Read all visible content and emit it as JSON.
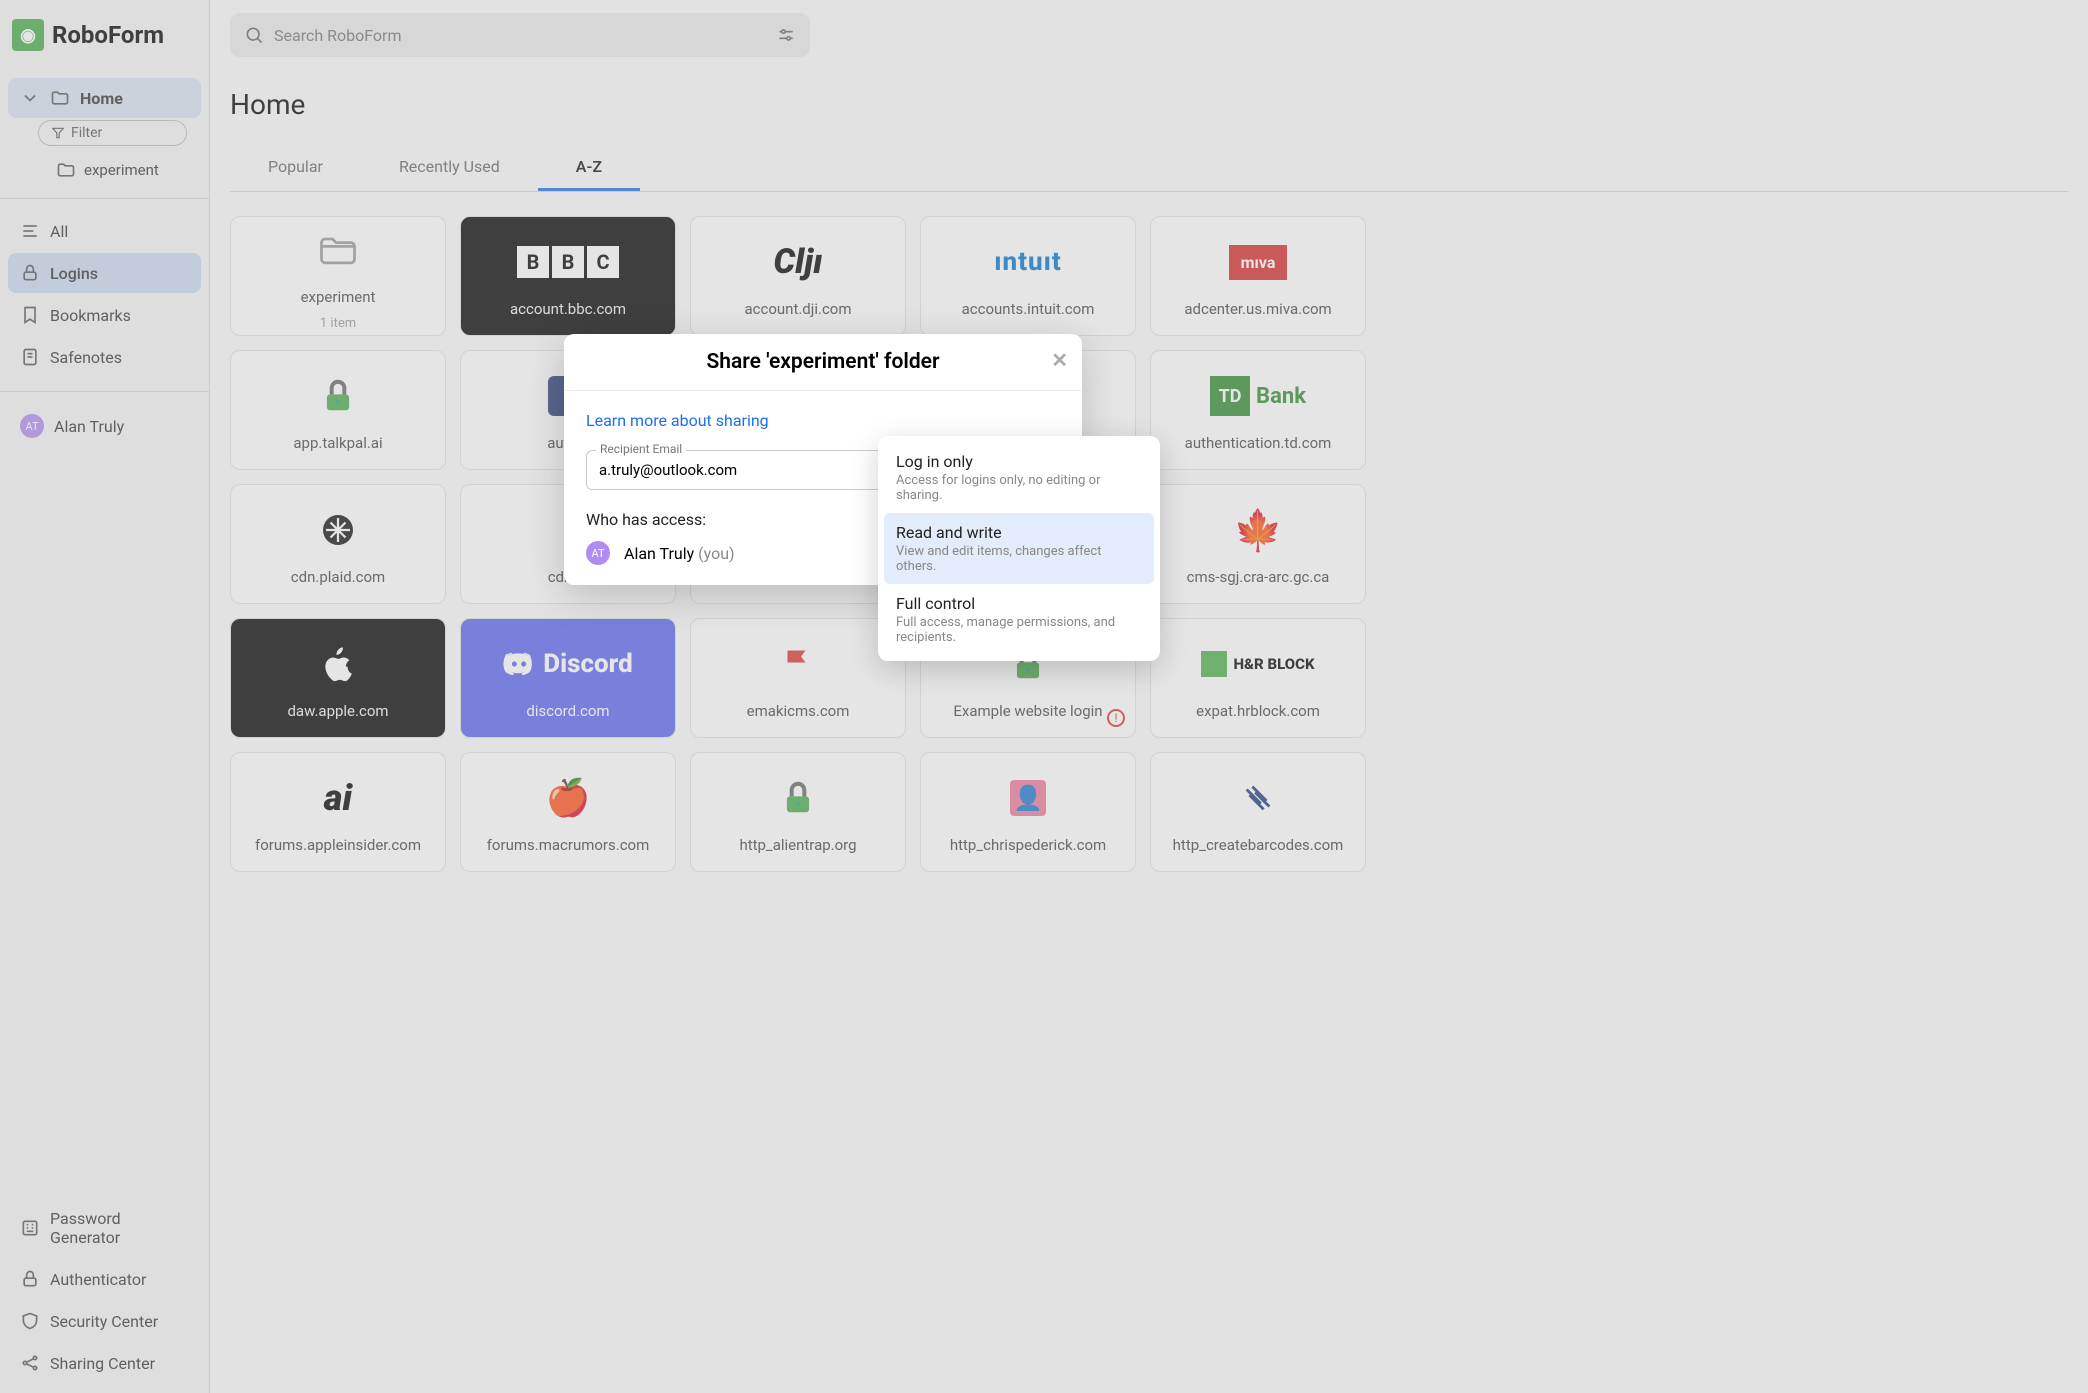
{
  "appName": "RoboForm",
  "search": {
    "placeholder": "Search RoboForm"
  },
  "sidebar": {
    "home": "Home",
    "filter": "Filter",
    "experiment": "experiment",
    "all": "All",
    "logins": "Logins",
    "bookmarks": "Bookmarks",
    "safenotes": "Safenotes",
    "user": {
      "initials": "AT",
      "name": "Alan Truly"
    },
    "bottom": {
      "pwgen": "Password Generator",
      "auth": "Authenticator",
      "sec": "Security Center",
      "share": "Sharing Center"
    }
  },
  "page": {
    "title": "Home"
  },
  "tabs": {
    "popular": "Popular",
    "recent": "Recently Used",
    "az": "A-Z"
  },
  "cards": [
    {
      "label": "experiment",
      "sub": "1 item",
      "icon": "folder"
    },
    {
      "label": "account.bbc.com",
      "style": "black",
      "icon": "bbc"
    },
    {
      "label": "account.dji.com",
      "icon": "dji"
    },
    {
      "label": "accounts.intuit.com",
      "icon": "intuit"
    },
    {
      "label": "adcenter.us.miva.com",
      "icon": "miva"
    },
    {
      "label": "app.talkpal.ai",
      "icon": "greenlock"
    },
    {
      "label": "auth.e",
      "icon": "blue"
    },
    {
      "label": "",
      "icon": ""
    },
    {
      "label": "",
      "icon": ""
    },
    {
      "label": "authentication.td.com",
      "icon": "td"
    },
    {
      "label": "cdn.plaid.com",
      "icon": "plaid"
    },
    {
      "label": "cdn.pl",
      "icon": ""
    },
    {
      "label": "",
      "icon": ""
    },
    {
      "label": "",
      "icon": ""
    },
    {
      "label": "cms-sgj.cra-arc.gc.ca",
      "icon": "maple"
    },
    {
      "label": "daw.apple.com",
      "style": "black",
      "icon": "apple"
    },
    {
      "label": "discord.com",
      "style": "indigo",
      "icon": "discord"
    },
    {
      "label": "emakicms.com",
      "icon": "flag"
    },
    {
      "label": "Example website login",
      "icon": "greenlock",
      "warn": true
    },
    {
      "label": "expat.hrblock.com",
      "icon": "hrblock"
    },
    {
      "label": "forums.appleinsider.com",
      "icon": "ai"
    },
    {
      "label": "forums.macrumors.com",
      "icon": "macrumors"
    },
    {
      "label": "http_alientrap.org",
      "icon": "greenlock"
    },
    {
      "label": "http_chrispederick.com",
      "icon": "avatar"
    },
    {
      "label": "http_createbarcodes.com",
      "icon": "barcode"
    }
  ],
  "modal": {
    "title": "Share 'experiment' folder",
    "learn": "Learn more about sharing",
    "emailLabel": "Recipient Email",
    "emailValue": "a.truly@outlook.com",
    "who": "Who has access:",
    "accessUser": "Alan Truly",
    "you": "(you)"
  },
  "dropdown": {
    "opts": [
      {
        "title": "Log in only",
        "desc": "Access for logins only, no editing or sharing."
      },
      {
        "title": "Read and write",
        "desc": "View and edit items, changes affect others."
      },
      {
        "title": "Full control",
        "desc": "Full access, manage permissions, and recipients."
      }
    ]
  }
}
